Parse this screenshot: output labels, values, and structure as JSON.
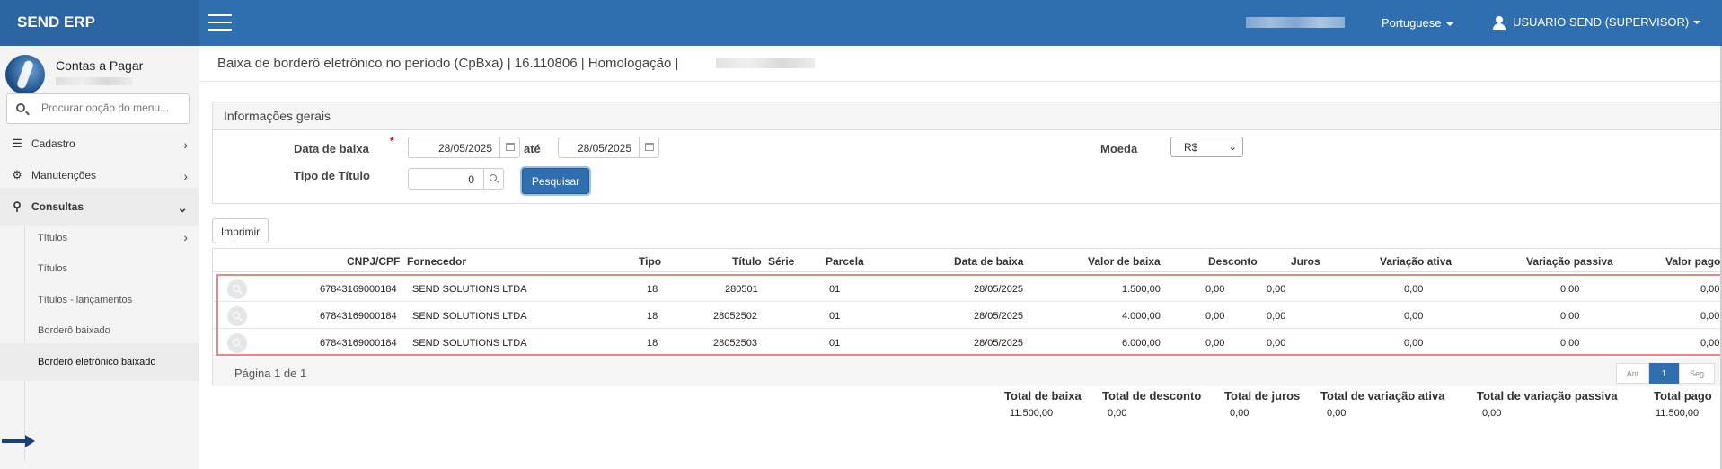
{
  "app": {
    "brand": "SEND ERP"
  },
  "header": {
    "language": "Portuguese",
    "user": "USUARIO SEND (SUPERVISOR)"
  },
  "sidebar": {
    "module": "Contas a Pagar",
    "search_placeholder": "Procurar opção do menu...",
    "items": [
      {
        "label": "Cadastro",
        "icon": "list-icon"
      },
      {
        "label": "Manutenções",
        "icon": "gears-icon"
      },
      {
        "label": "Consultas",
        "icon": "search-icon"
      }
    ],
    "subitems": [
      {
        "label": "Títulos"
      },
      {
        "label": "Títulos"
      },
      {
        "label": "Títulos - lançamentos"
      },
      {
        "label": "Borderô baixado"
      },
      {
        "label": "Borderô eletrônico baixado"
      }
    ]
  },
  "page": {
    "title": "Baixa de borderô eletrônico no período (CpBxa) | 16.110806 | Homologação |"
  },
  "form": {
    "section_title": "Informações gerais",
    "data_baixa_label": "Data de baixa",
    "required_mark": "*",
    "date_from": "28/05/2025",
    "ate_label": "até",
    "date_to": "28/05/2025",
    "moeda_label": "Moeda",
    "moeda_value": "R$",
    "tipo_titulo_label": "Tipo de Título",
    "tipo_titulo_value": "0",
    "search_button": "Pesquisar"
  },
  "print_button": "Imprimir",
  "table": {
    "headers": [
      "CNPJ/CPF",
      "Fornecedor",
      "Tipo",
      "Título",
      "Série",
      "Parcela",
      "Data de baixa",
      "Valor de baixa",
      "Desconto",
      "Juros",
      "Variação ativa",
      "Variação passiva",
      "Valor pago"
    ],
    "rows": [
      [
        "67843169000184",
        "SEND SOLUTIONS LTDA",
        "18",
        "280501",
        "",
        "01",
        "28/05/2025",
        "1.500,00",
        "0,00",
        "0,00",
        "0,00",
        "0,00",
        "0,00"
      ],
      [
        "67843169000184",
        "SEND SOLUTIONS LTDA",
        "18",
        "28052502",
        "",
        "01",
        "28/05/2025",
        "4.000,00",
        "0,00",
        "0,00",
        "0,00",
        "0,00",
        "0,00"
      ],
      [
        "67843169000184",
        "SEND SOLUTIONS LTDA",
        "18",
        "28052503",
        "",
        "01",
        "28/05/2025",
        "6.000,00",
        "0,00",
        "0,00",
        "0,00",
        "0,00",
        "0,00"
      ]
    ]
  },
  "pager": {
    "text": "Página 1 de 1",
    "prev": "Ant",
    "current": "1",
    "next": "Seg"
  },
  "totals": {
    "headers": [
      "Total de baixa",
      "Total de desconto",
      "Total de juros",
      "Total de variação ativa",
      "Total de variação passiva",
      "Total pago"
    ],
    "values": [
      "11.500,00",
      "0,00",
      "0,00",
      "0,00",
      "0,00",
      "11.500,00"
    ]
  }
}
